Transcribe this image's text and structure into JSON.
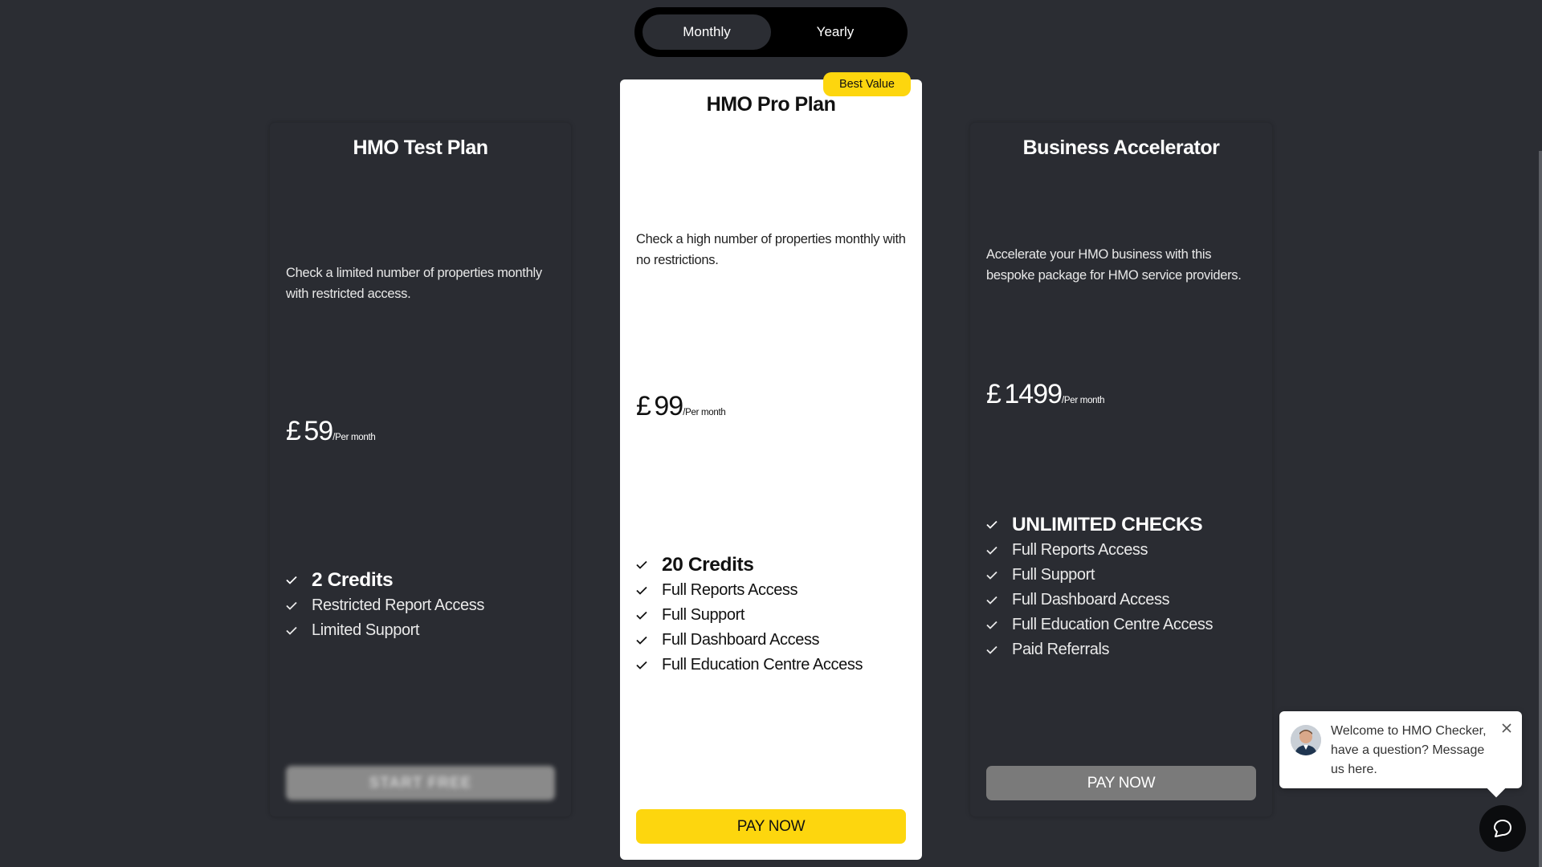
{
  "toggle": {
    "monthly": "Monthly",
    "yearly": "Yearly",
    "selected": "Monthly"
  },
  "plans": [
    {
      "title": "HMO Test Plan",
      "description": "Check a limited number of properties monthly with restricted access.",
      "currency": "£",
      "price": "59",
      "period": "/Per month",
      "features": [
        "2 Credits",
        "Restricted Report Access",
        "Limited Support"
      ],
      "button": "START FREE"
    },
    {
      "title": "HMO Pro Plan",
      "badge": "Best Value",
      "description": "Check a high number of properties monthly with no restrictions.",
      "currency": "£",
      "price": "99",
      "period": "/Per month",
      "features": [
        "20 Credits",
        "Full Reports Access",
        "Full Support",
        "Full Dashboard Access",
        "Full Education Centre Access"
      ],
      "button": "PAY NOW"
    },
    {
      "title": "Business Accelerator",
      "description": "Accelerate your HMO business with this bespoke package for HMO service providers.",
      "currency": "£",
      "price": "1499",
      "period": "/Per month",
      "features": [
        "UNLIMITED CHECKS",
        "Full Reports Access",
        "Full Support",
        "Full Dashboard Access",
        "Full Education Centre Access",
        "Paid Referrals"
      ],
      "button": "PAY NOW"
    }
  ],
  "chat": {
    "message": "Welcome to HMO Checker, have a question? Message us here.",
    "icons": {
      "close": "close-icon",
      "launcher": "chat-icon"
    }
  },
  "colors": {
    "accent": "#fdd60e",
    "background": "#2b2d33",
    "card_dark": "#2a2c32",
    "button_grey": "#7a7a7a"
  }
}
